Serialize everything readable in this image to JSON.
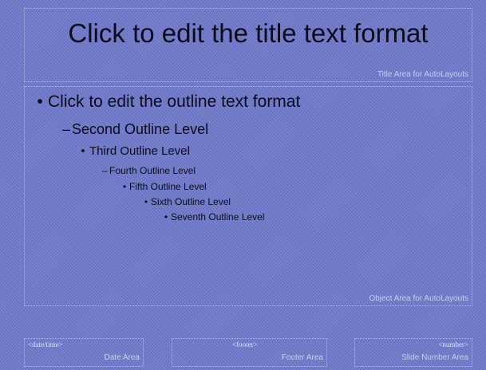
{
  "title": {
    "text": "Click to edit the title text format",
    "area_label": "Title Area for AutoLayouts"
  },
  "outline": {
    "area_label": "Object Area for AutoLayouts",
    "levels": [
      {
        "bullet": "•",
        "text": "Click to edit the outline text format"
      },
      {
        "bullet": "–",
        "text": "Second Outline Level"
      },
      {
        "bullet": "•",
        "text": "Third Outline Level"
      },
      {
        "bullet": "–",
        "text": "Fourth Outline Level"
      },
      {
        "bullet": "•",
        "text": "Fifth Outline Level"
      },
      {
        "bullet": "•",
        "text": "Sixth Outline Level"
      },
      {
        "bullet": "•",
        "text": "Seventh Outline Level"
      }
    ]
  },
  "footer": {
    "date": {
      "placeholder": "<date/time>",
      "label": "Date Area"
    },
    "footer": {
      "placeholder": "<footer>",
      "label": "Footer Area"
    },
    "number": {
      "placeholder": "<number>",
      "label": "Slide Number Area"
    }
  },
  "colors": {
    "background": "#6f79c8",
    "text": "#0b0b1a",
    "label": "#c9cdf0"
  }
}
